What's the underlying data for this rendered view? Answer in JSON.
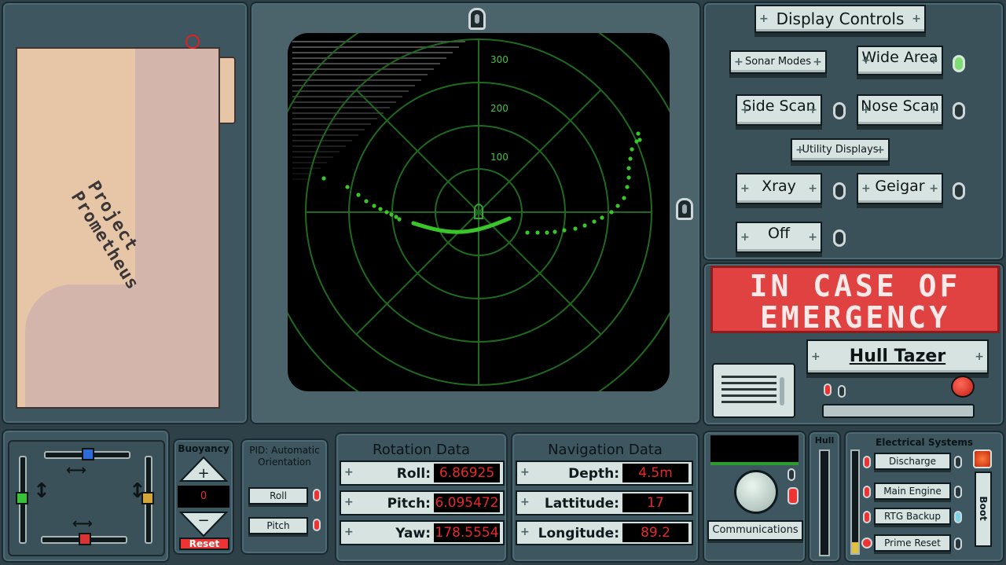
{
  "map": {
    "title": "Project Prometheus"
  },
  "sonar": {
    "range_labels": [
      "300",
      "200",
      "100"
    ],
    "rings": 5,
    "trail_color": "#39c629",
    "grid_color": "#1f6a1f"
  },
  "display_controls": {
    "title": "Display  Controls",
    "sonar_modes_label": "Sonar Modes",
    "wide_area_label": "Wide Area",
    "side_scan_label": "Side Scan",
    "nose_scan_label": "Nose Scan",
    "utility_displays_label": "Utility Displays",
    "xray_label": "Xray",
    "geigar_label": "Geigar",
    "off_label": "Off"
  },
  "emergency": {
    "sign_line1": "IN CASE OF",
    "sign_line2": "EMERGENCY",
    "hull_tazer_label": "Hull Tazer"
  },
  "buoyancy": {
    "title": "Buoyancy",
    "value": "0",
    "reset_label": "Reset",
    "up_icon": "plus-icon",
    "down_icon": "minus-icon"
  },
  "pid": {
    "title": "PID: Automatic Orientation",
    "roll_label": "Roll",
    "pitch_label": "Pitch"
  },
  "rotation": {
    "title": "Rotation Data",
    "rows": [
      {
        "label": "Roll:",
        "value": "6.86925"
      },
      {
        "label": "Pitch:",
        "value": "6.095472"
      },
      {
        "label": "Yaw:",
        "value": "178.5554"
      }
    ]
  },
  "navigation": {
    "title": "Navigation Data",
    "rows": [
      {
        "label": "Depth:",
        "value": "4.5m"
      },
      {
        "label": "Lattitude:",
        "value": "17"
      },
      {
        "label": "Longitude:",
        "value": "89.2"
      }
    ]
  },
  "comms": {
    "label": "Communications"
  },
  "hull": {
    "title": "Hull"
  },
  "electrical": {
    "title": "Electrical Systems",
    "discharge_label": "Discharge",
    "main_engine_label": "Main Engine",
    "rtg_backup_label": "RTG Backup",
    "prime_reset_label": "Prime Reset",
    "boot_label": "Boot"
  }
}
